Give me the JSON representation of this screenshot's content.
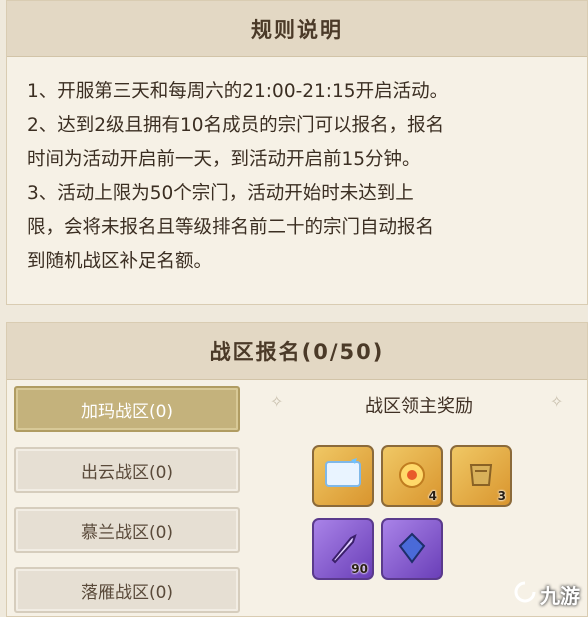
{
  "rules": {
    "title": "规则说明",
    "lines": [
      "1、开服第三天和每周六的21:00-21:15开启活动。",
      "2、达到2级且拥有10名成员的宗门可以报名，报名",
      "时间为活动开启前一天，到活动开启前15分钟。",
      "3、活动上限为50个宗门，活动开始时未达到上",
      "限，会将未报名且等级排名前二十的宗门自动报名",
      "到随机战区补足名额。"
    ]
  },
  "registration": {
    "title": "战区报名(0/50)",
    "zones": [
      {
        "label": "加玛战区(0)",
        "active": true
      },
      {
        "label": "出云战区(0)",
        "active": false
      },
      {
        "label": "慕兰战区(0)",
        "active": false
      },
      {
        "label": "落雁战区(0)",
        "active": false
      }
    ]
  },
  "rewards": {
    "title": "战区领主奖励",
    "items": [
      {
        "icon": "card-frame-icon",
        "count": "",
        "rarity": "gold"
      },
      {
        "icon": "golden-orb-icon",
        "count": "4",
        "rarity": "gold"
      },
      {
        "icon": "golden-armor-icon",
        "count": "3",
        "rarity": "gold"
      },
      {
        "icon": "purple-arrow-icon",
        "count": "90",
        "rarity": "purple"
      },
      {
        "icon": "blue-crystal-icon",
        "count": "",
        "rarity": "purple"
      }
    ]
  },
  "watermark": {
    "text": "九游"
  }
}
